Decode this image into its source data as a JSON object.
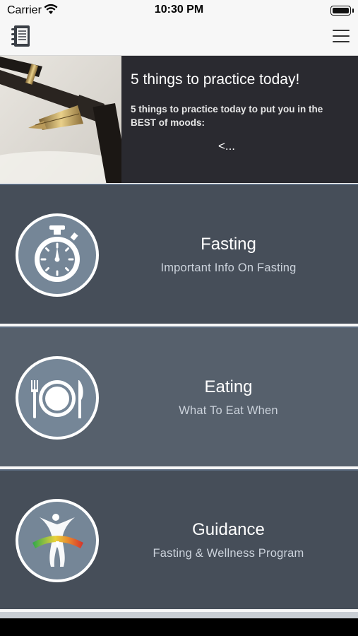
{
  "status": {
    "carrier": "Carrier",
    "time": "10:30 PM"
  },
  "navbar": {
    "left_icon": "notebook-icon",
    "right_icon": "hamburger-menu-icon"
  },
  "banner": {
    "title": "5 things to practice today!",
    "description": "5 things to practice today to put you in the BEST of moods:",
    "more": "<..."
  },
  "tiles": [
    {
      "title": "Fasting",
      "subtitle": "Important Info On Fasting",
      "icon": "stopwatch-icon"
    },
    {
      "title": "Eating",
      "subtitle": "What To Eat When",
      "icon": "plate-cutlery-icon"
    },
    {
      "title": "Guidance",
      "subtitle": "Fasting & Wellness Program",
      "icon": "body-gauge-icon"
    }
  ],
  "colors": {
    "tile_dark": "#464e59",
    "tile_light": "#56606c",
    "banner_bg": "#2a2a30",
    "icon_circle": "#758697"
  }
}
